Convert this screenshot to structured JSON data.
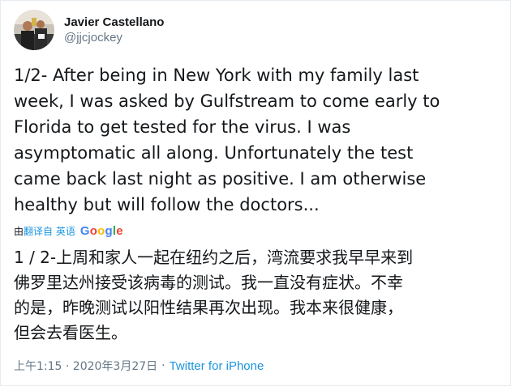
{
  "author": {
    "display_name": "Javier Castellano",
    "handle": "@jjcjockey",
    "avatar_icon": "profile-photo"
  },
  "tweet": {
    "text": "1/2- After being in New York with my family last\nweek, I was asked by Gulfstream to come early to\nFlorida to get tested for the virus. I was\nasymptomatic all along. Unfortunately the test\ncame back last night as positive. I am otherwise\nhealthy but will follow the doctors..."
  },
  "translation": {
    "prefix": "由",
    "link_label": "翻译自 英语",
    "provider": "Google",
    "text": "1 / 2-上周和家人一起在纽约之后，湾流要求我早早来到\n佛罗里达州接受该病毒的测试。我一直没有症状。不幸\n的是，昨晚测试以阳性结果再次出现。我本来很健康，\n但会去看医生。"
  },
  "meta": {
    "timestamp": "上午1:15 · 2020年3月27日",
    "separator": "·",
    "source": "Twitter for iPhone"
  },
  "colors": {
    "text_primary": "#14171a",
    "text_secondary": "#657786",
    "link": "#1b95e0",
    "google_blue": "#4285f4",
    "google_red": "#ea4335",
    "google_yellow": "#fbbc05",
    "google_green": "#34a853"
  }
}
